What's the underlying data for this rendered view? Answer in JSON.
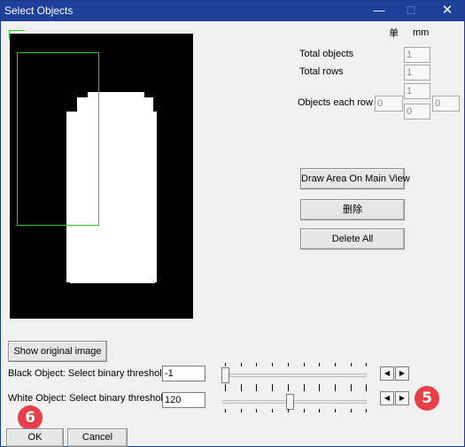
{
  "window": {
    "title": "Select Objects",
    "min_glyph": "—",
    "max_glyph": "☐",
    "close_glyph": "✕"
  },
  "units": {
    "a": "单",
    "b": "mm"
  },
  "stats": {
    "total_objects_label": "Total objects",
    "total_objects_value": "1",
    "total_rows_label": "Total rows",
    "total_rows_value": "1",
    "objects_each_row_label": "Objects each row",
    "each_row_top": "1",
    "each_row_left": "0",
    "each_row_center": "0",
    "each_row_right": "0"
  },
  "actions": {
    "draw_area": "Draw Area On Main View",
    "delete": "删除",
    "delete_all": "Delete All",
    "show_original": "Show original image"
  },
  "threshold": {
    "black_label": "Black Object: Select binary threshold",
    "black_value": "-1",
    "white_label": "White Object: Select binary threshold",
    "white_value": "120",
    "left_arrow": "◀",
    "right_arrow": "▶"
  },
  "footer": {
    "ok": "OK",
    "cancel": "Cancel"
  },
  "annotations": {
    "step5": "5",
    "step6": "6"
  },
  "colors": {
    "titlebar": "#1e3f9a",
    "selection": "#1fd11f",
    "badge": "#e8404a"
  }
}
